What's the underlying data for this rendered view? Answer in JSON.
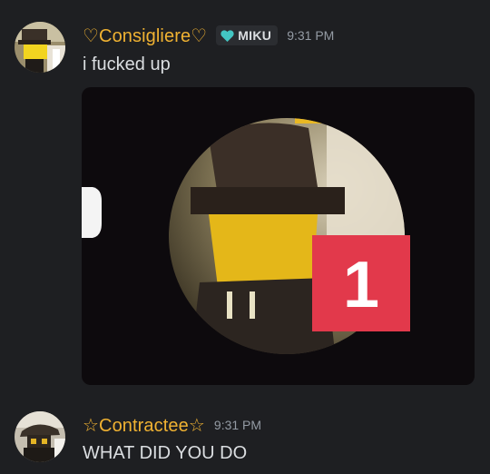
{
  "messages": [
    {
      "username": "♡Consigliere♡",
      "tag": {
        "icon": "heart-icon",
        "label": "MIKU",
        "icon_color": "#43c6c3"
      },
      "timestamp": "9:31 PM",
      "text": "i fucked up",
      "attachment": {
        "kind": "image",
        "badge_count": "1",
        "badge_color": "#e2394b"
      }
    },
    {
      "username": "☆Contractee☆",
      "timestamp": "9:31 PM",
      "text": "WHAT DID YOU DO"
    }
  ],
  "colors": {
    "background": "#1e1f22",
    "username": "#f0b232",
    "timestamp": "#949ba4",
    "text": "#dbdee1"
  }
}
